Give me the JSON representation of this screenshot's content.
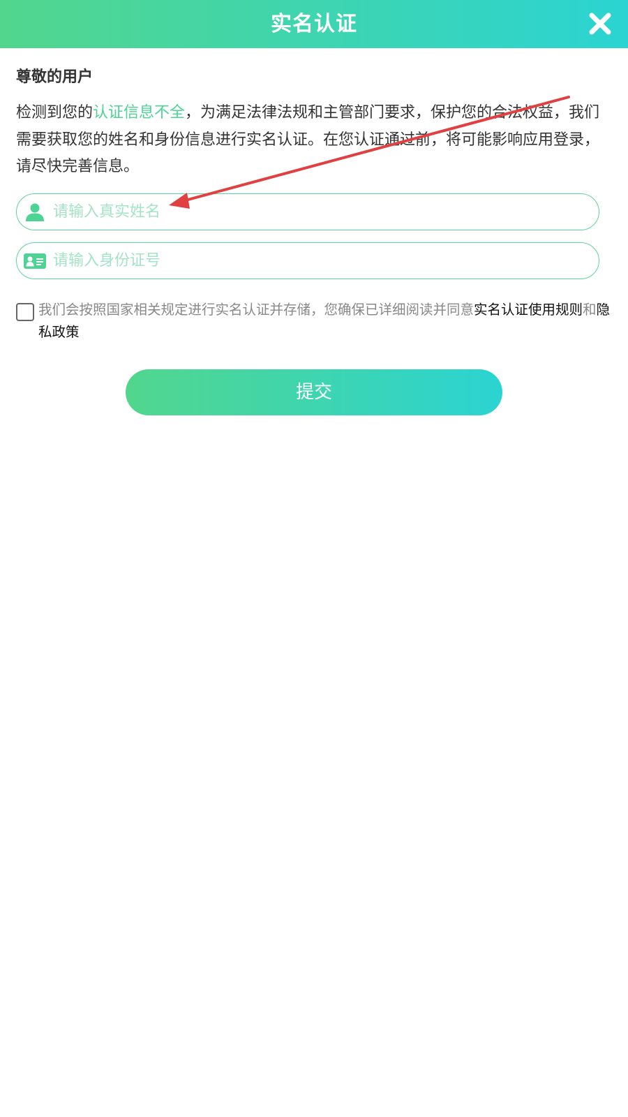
{
  "header": {
    "title": "实名认证",
    "close_icon": "close-icon"
  },
  "greeting": "尊敬的用户",
  "description": {
    "part1": "检测到您的",
    "highlight": "认证信息不全",
    "part2": "，为满足法律法规和主管部门要求，保护您的合法权益，我们需要获取您的姓名和身份信息进行实名认证。在您认证通过前，将可能影响应用登录，请尽快完善信息。"
  },
  "form": {
    "name_placeholder": "请输入真实姓名",
    "name_icon": "user-icon",
    "id_placeholder": "请输入身份证号",
    "id_icon": "id-card-icon"
  },
  "agreement": {
    "text": "我们会按照国家相关规定进行实名认证并存储，您确保已详细阅读并同意",
    "rules_link": "实名认证使用规则",
    "conjunction": "和",
    "privacy_link": "隐私政策",
    "checked": false
  },
  "submit_label": "提交",
  "colors": {
    "accent_start": "#52d68d",
    "accent_end": "#2bd4d2",
    "highlight": "#4dd394",
    "annotation_arrow": "#e04040"
  }
}
